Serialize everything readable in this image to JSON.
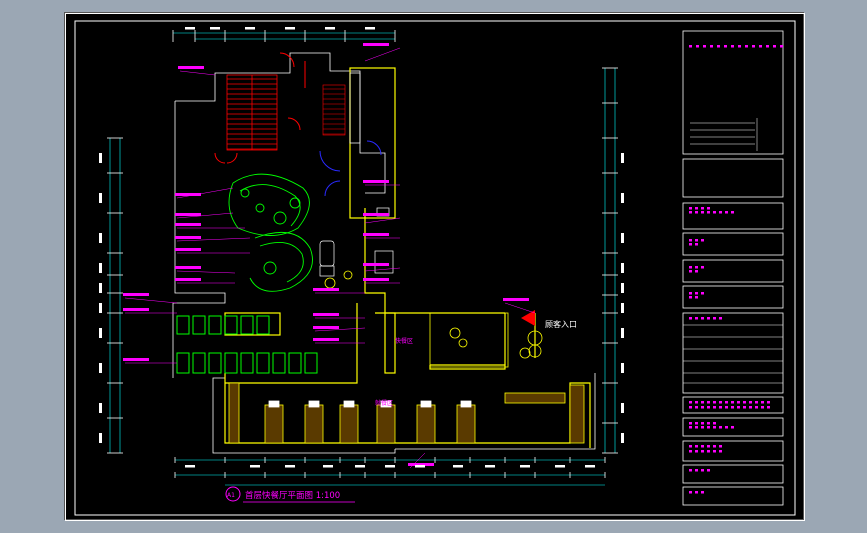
{
  "drawing": {
    "title": "首层快餐厅平面图 1:100",
    "title_tag": "A1"
  },
  "labels": {
    "entrance": "顾客入口",
    "seating_a": "快餐区",
    "seating_b": "就餐区"
  },
  "colors": {
    "background": "#000000",
    "frame": "#ffffff",
    "wall": "#ffff00",
    "furniture": "#00ff00",
    "annotation": "#ff00ff",
    "dimension": "#00ffff",
    "door": "#ff0000",
    "swing": "#0000ff",
    "outline": "#ffffff"
  }
}
